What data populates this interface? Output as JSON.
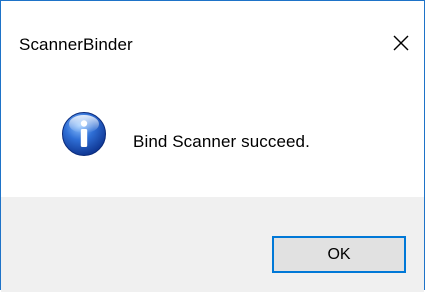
{
  "window": {
    "title": "ScannerBinder",
    "close_icon": "close-icon",
    "border_color": "#1e73c8"
  },
  "message": {
    "icon": "info-icon",
    "text": "Bind Scanner succeed."
  },
  "footer": {
    "ok_label": "OK",
    "accent": "#0078d7"
  }
}
